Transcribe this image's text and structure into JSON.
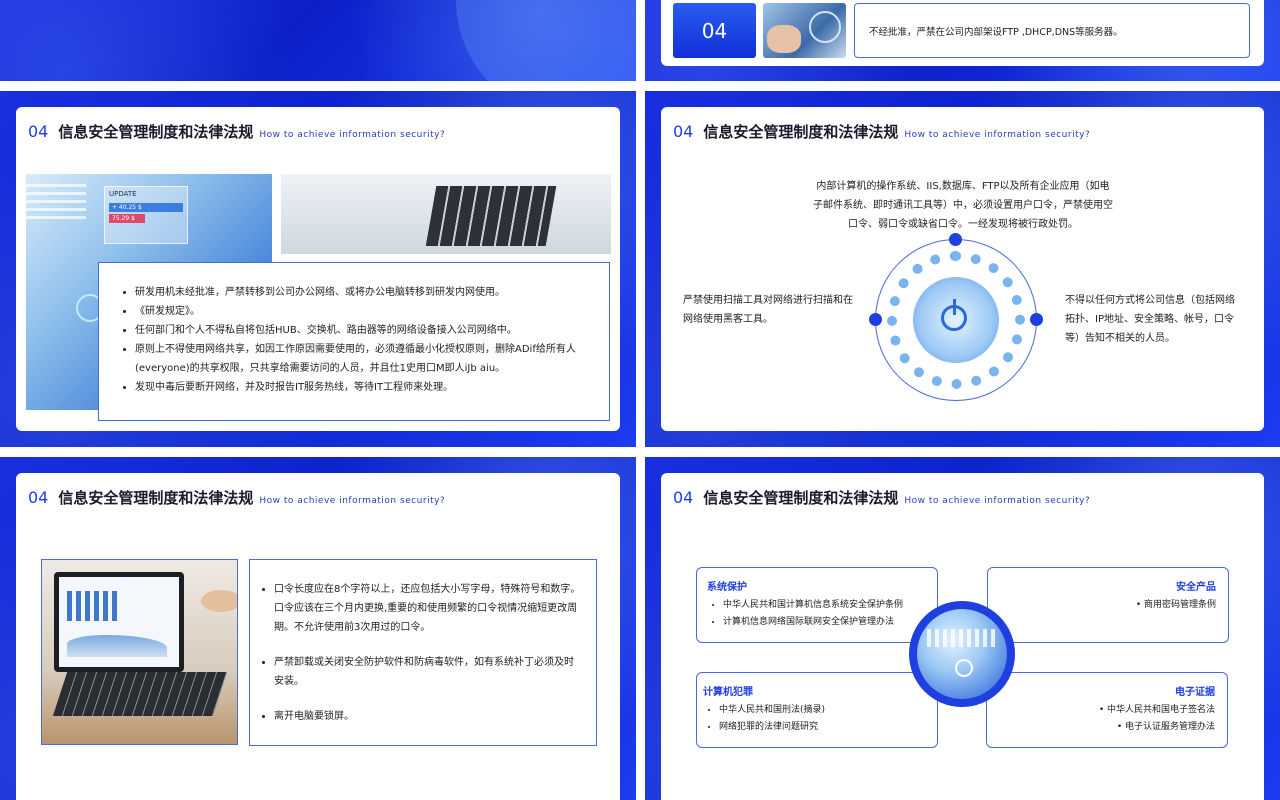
{
  "slides": {
    "s2": {
      "num": "04",
      "note": "不经批准，严禁在公司内部架设FTP ,DHCP,DNS等服务器。"
    },
    "s3": {
      "num": "04",
      "title": "信息安全管理制度和法律法规",
      "subtitle": "How to achieve information security?",
      "bullets": [
        "研发用机未经批准，严禁转移到公司办公网络、或将办公电脑转移到研发内网使用。",
        "《研发规定》。",
        "任何部门和个人不得私自将包括HUB、交换机、路由器等的网络设备接入公司网络中。",
        "原则上不得使用网络共享，如因工作原因需要使用的，必须遵循最小化授权原则，删除ADif给所有人(everyone)的共享权限，只共享给需要访问的人员，并且仕1史用口M即人iJb  aiu。",
        "发现中毒后要断开网络，并及时报告IT服务热线，等待IT工程师来处理。"
      ],
      "image_text": {
        "update": "UPDATE",
        "price1": "+ 40.25 $",
        "price2": "75.29 $"
      }
    },
    "s4": {
      "num": "04",
      "title": "信息安全管理制度和法律法规",
      "subtitle": "How to achieve information security?",
      "top": "内部计算机的操作系统、IIS,数据库、FTP以及所有企业应用（如电子邮件系统、即时通讯工具等）中，必须设置用户口令，严禁使用空口令、弱口令或缺省口令。一经发现将被行政处罚。",
      "left": "严禁使用扫描工具对网络进行扫描和在网络使用黑客工具。",
      "right": "不得以任何方式将公司信息（包括网络拓扑、IP地址、安全策略、帐号，口令等）告知不相关的人员。"
    },
    "s5": {
      "num": "04",
      "title": "信息安全管理制度和法律法规",
      "subtitle": "How to achieve information security?",
      "bullets": [
        "口令长度应在8个字符以上，还应包括大小写字母，特殊符号和数字。口令应该在三个月内更换,重要的和使用频繁的口令视情况缩短更改周期。不允许使用前3次用过的口令。",
        "严禁卸载或关闭安全防护软件和防病毒软件，如有系统补丁必须及时安装。",
        "离开电脑要锁屏。"
      ]
    },
    "s6": {
      "num": "04",
      "title": "信息安全管理制度和法律法规",
      "subtitle": "How to achieve information security?",
      "boxes": {
        "tl": {
          "title": "系统保护",
          "items": [
            "中华人民共和国计算机信息系统安全保护条例",
            "计算机信息网络国际联网安全保护管理办法"
          ]
        },
        "tr": {
          "title": "安全产品",
          "items": [
            "商用密码管理条例"
          ]
        },
        "bl": {
          "title": "计算机犯罪",
          "items": [
            "中华人民共和国刑法(摘录)",
            "网络犯罪的法律问题研究"
          ]
        },
        "br": {
          "title": "电子证据",
          "items": [
            "中华人民共和国电子签名法",
            "电子认证服务管理办法"
          ]
        }
      }
    }
  },
  "colors": {
    "accent": "#1f3fe0",
    "bg_blue": "#0b20c8",
    "border": "#4a6ad8"
  }
}
